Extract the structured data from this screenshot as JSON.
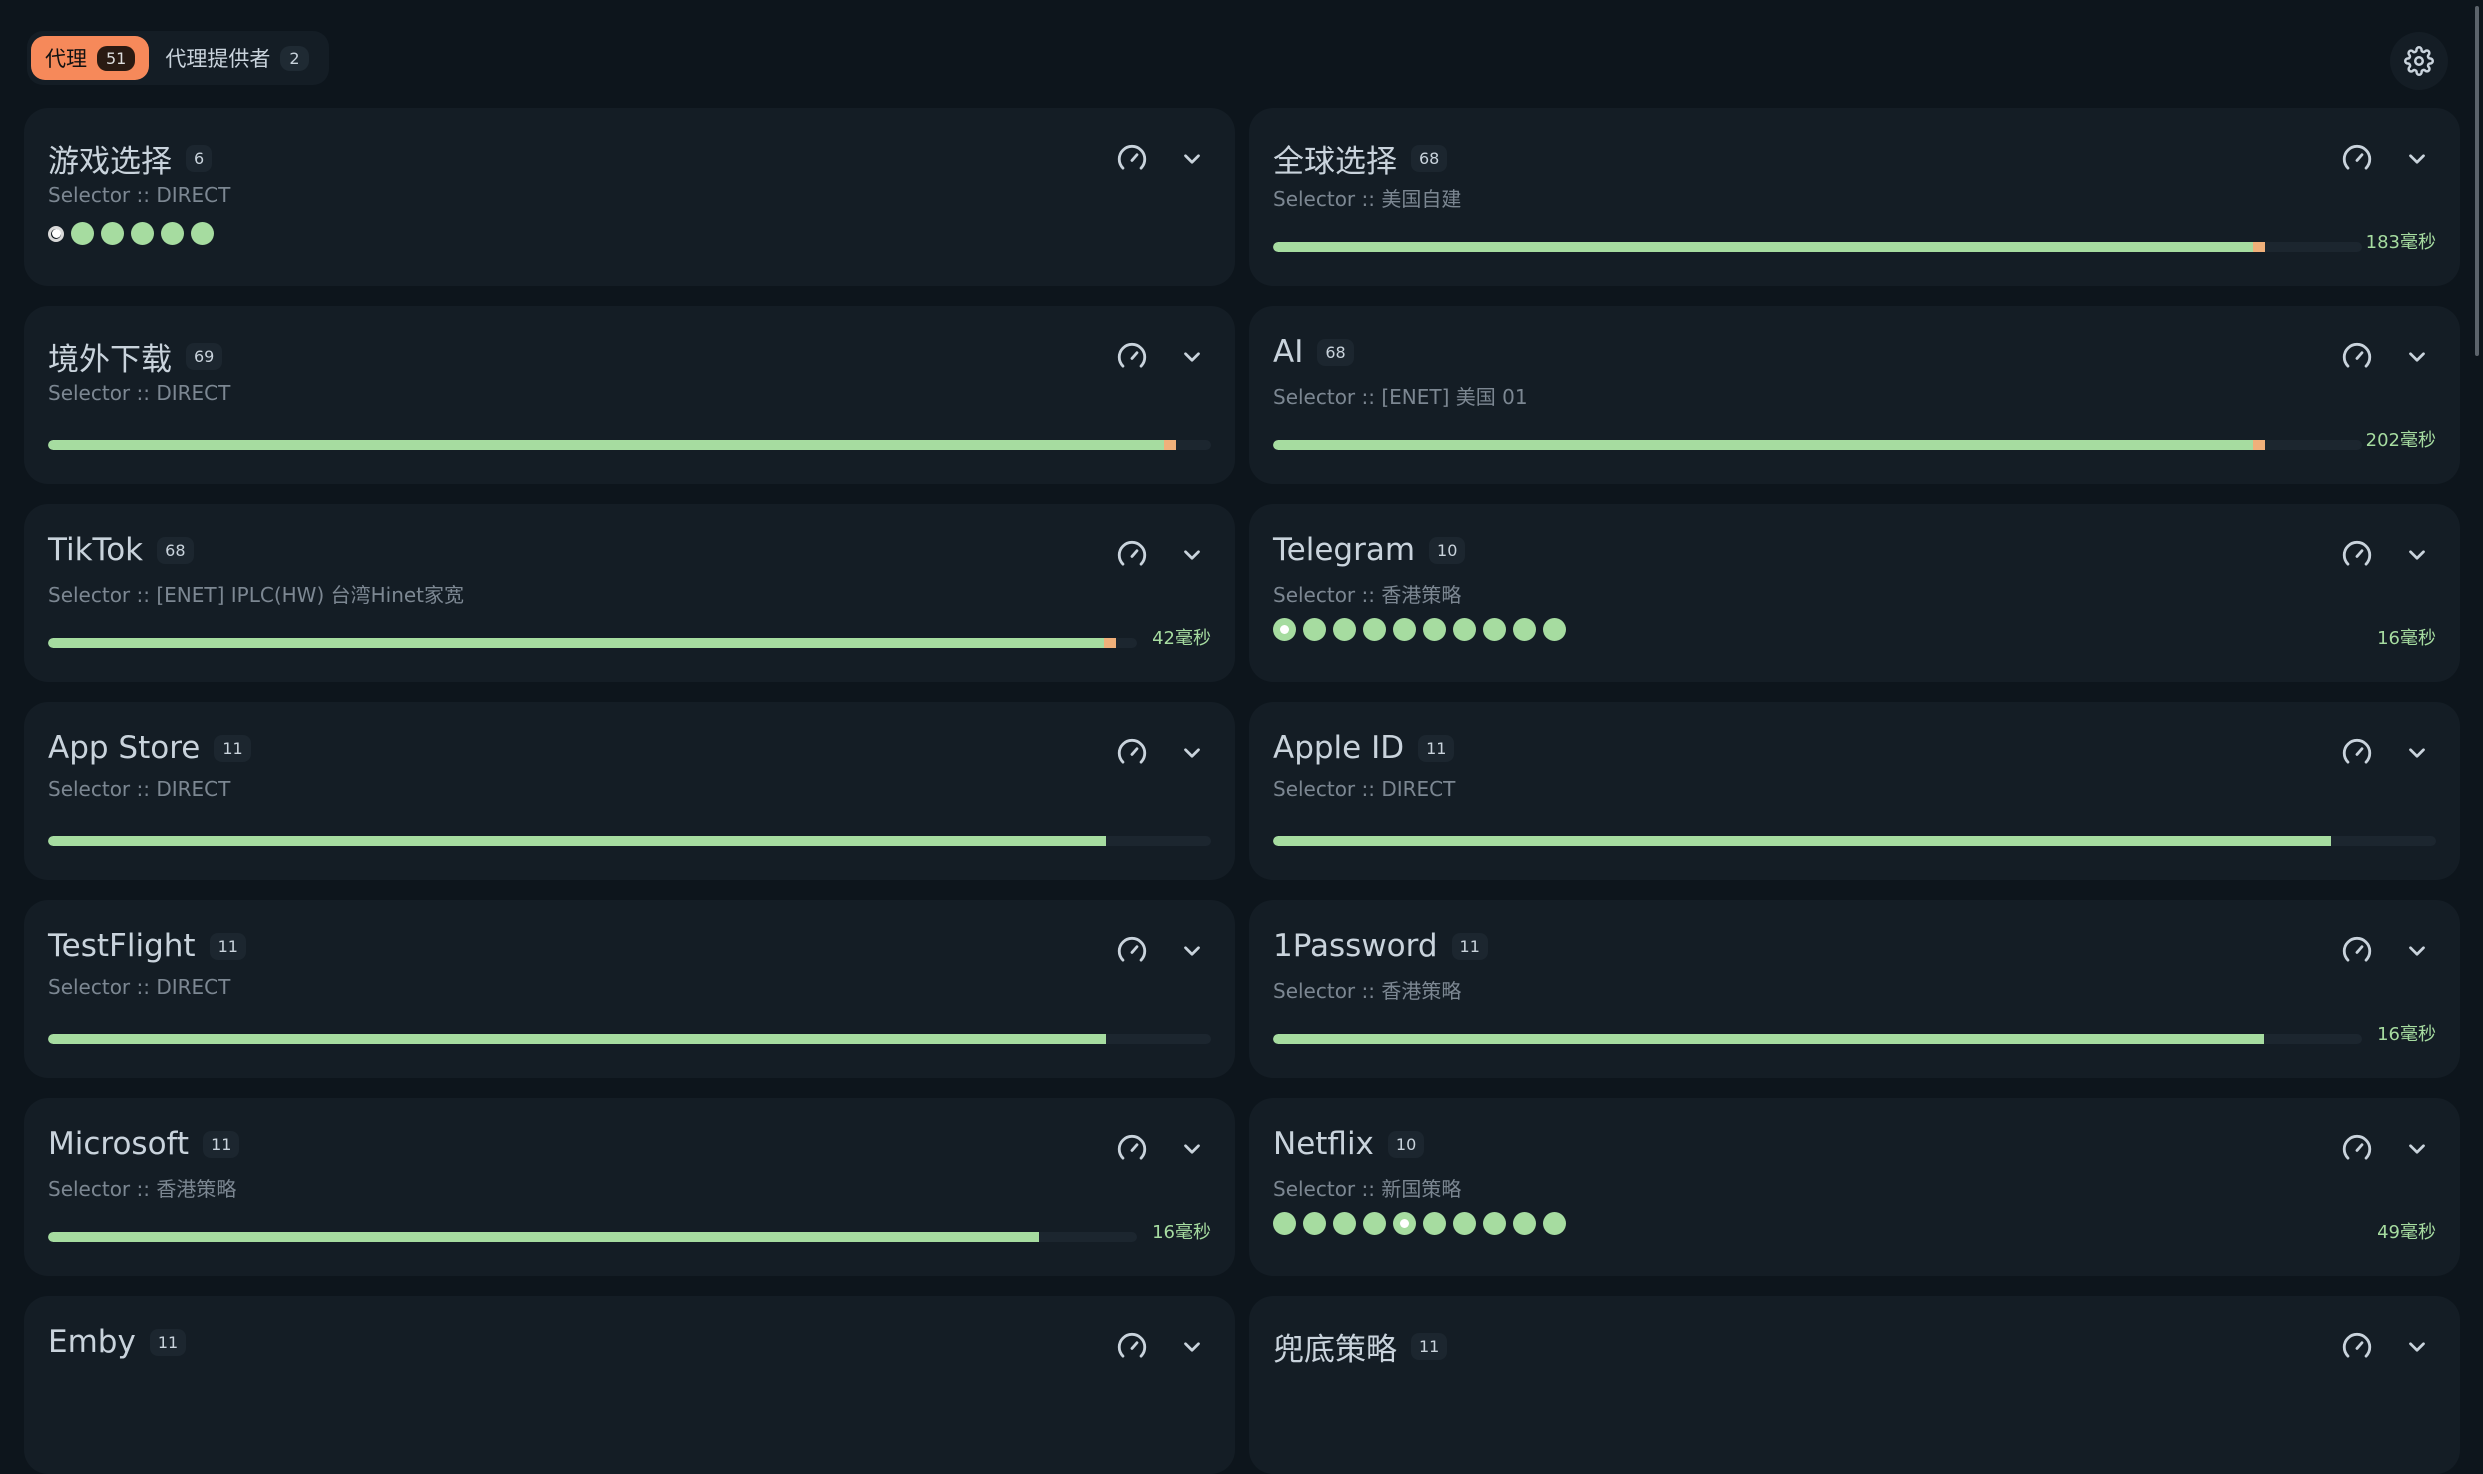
{
  "tabs": [
    {
      "label": "代理",
      "count": "51",
      "active": true
    },
    {
      "label": "代理提供者",
      "count": "2",
      "active": false
    }
  ],
  "groups": [
    {
      "name": "游戏选择",
      "count": "6",
      "subtitle": "Selector :: DIRECT",
      "display": "dots",
      "dots": 6,
      "selected_dot": 0,
      "latency": ""
    },
    {
      "name": "全球选择",
      "count": "68",
      "subtitle": "Selector :: 美国自建",
      "display": "bar",
      "fill": 0.9,
      "tail": true,
      "latency": "183毫秒"
    },
    {
      "name": "境外下载",
      "count": "69",
      "subtitle": "Selector :: DIRECT",
      "display": "bar",
      "fill": 0.96,
      "tail": true,
      "latency": ""
    },
    {
      "name": "AI",
      "count": "68",
      "subtitle": "Selector :: [ENET] 美国 01",
      "display": "bar",
      "fill": 0.9,
      "tail": true,
      "latency": "202毫秒"
    },
    {
      "name": "TikTok",
      "count": "68",
      "subtitle": "Selector :: [ENET] IPLC(HW) 台湾Hinet家宽",
      "display": "bar",
      "fill": 0.97,
      "tail": true,
      "latency": "42毫秒"
    },
    {
      "name": "Telegram",
      "count": "10",
      "subtitle": "Selector :: 香港策略",
      "display": "dots",
      "dots": 10,
      "selected_dot": 0,
      "latency": "16毫秒"
    },
    {
      "name": "App Store",
      "count": "11",
      "subtitle": "Selector :: DIRECT",
      "display": "bar",
      "fill": 0.91,
      "tail": false,
      "latency": ""
    },
    {
      "name": "Apple ID",
      "count": "11",
      "subtitle": "Selector :: DIRECT",
      "display": "bar",
      "fill": 0.91,
      "tail": false,
      "latency": ""
    },
    {
      "name": "TestFlight",
      "count": "11",
      "subtitle": "Selector :: DIRECT",
      "display": "bar",
      "fill": 0.91,
      "tail": false,
      "latency": ""
    },
    {
      "name": "1Password",
      "count": "11",
      "subtitle": "Selector :: 香港策略",
      "display": "bar",
      "fill": 0.91,
      "tail": false,
      "latency": "16毫秒"
    },
    {
      "name": "Microsoft",
      "count": "11",
      "subtitle": "Selector :: 香港策略",
      "display": "bar",
      "fill": 0.91,
      "tail": false,
      "latency": "16毫秒"
    },
    {
      "name": "Netflix",
      "count": "10",
      "subtitle": "Selector :: 新国策略",
      "display": "dots",
      "dots": 10,
      "selected_dot": 4,
      "latency": "49毫秒"
    },
    {
      "name": "Emby",
      "count": "11",
      "subtitle": "",
      "display": "none",
      "latency": ""
    },
    {
      "name": "兜底策略",
      "count": "11",
      "subtitle": "",
      "display": "none",
      "latency": ""
    }
  ],
  "colors": {
    "background": "#0d151c",
    "card": "#141d25",
    "accent": "#f6895a",
    "good": "#a6dca0",
    "warn": "#f0b07a"
  },
  "icons": {
    "test": "speedometer-icon",
    "expand": "chevron-down-icon",
    "settings": "gear-icon"
  }
}
